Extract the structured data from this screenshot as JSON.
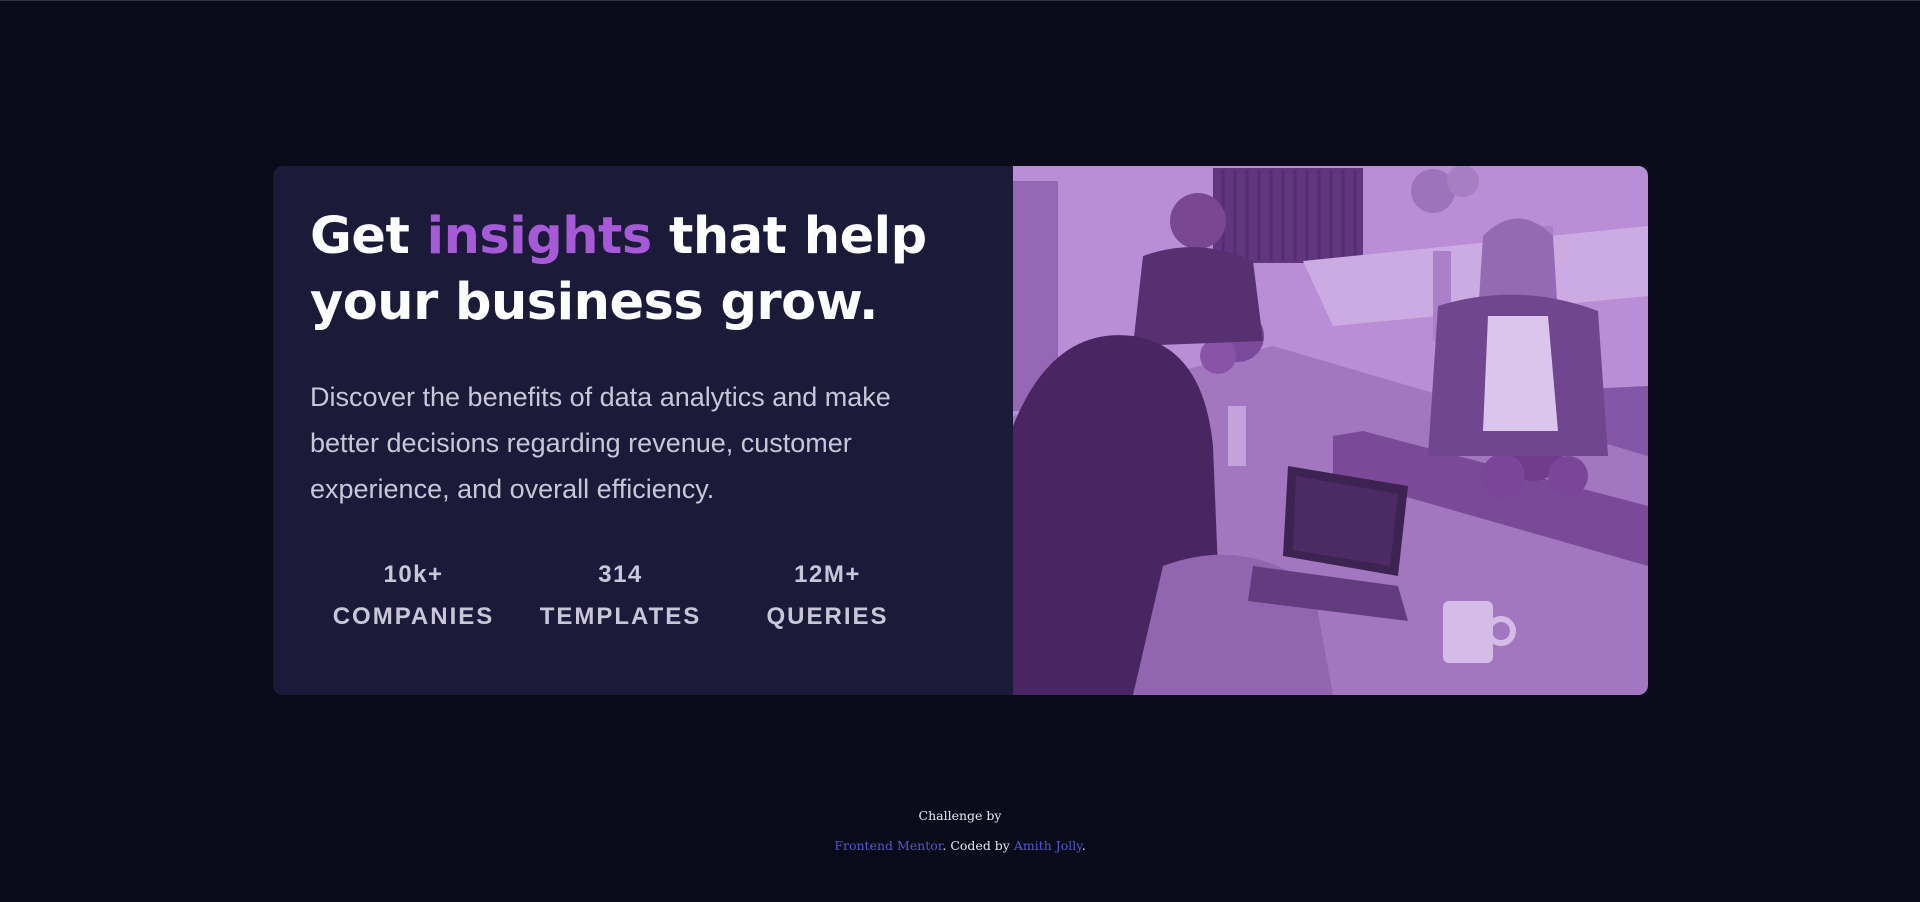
{
  "hero": {
    "headline_before": "Get ",
    "headline_accent": "insights",
    "headline_after": " that help your business grow.",
    "description": "Discover the benefits of data analytics and make better decisions regarding revenue, customer experience, and overall efficiency.",
    "stats": [
      {
        "value": "10k+",
        "label": "COMPANIES"
      },
      {
        "value": "314",
        "label": "TEMPLATES"
      },
      {
        "value": "12M+",
        "label": "QUERIES"
      }
    ],
    "image_icon": "office-photo-image"
  },
  "footer": {
    "line1": "Challenge by",
    "link1": "Frontend Mentor",
    "sep": ". Coded by ",
    "link2": "Amith Jolly",
    "end": "."
  },
  "colors": {
    "page_bg": "#090b1a",
    "card_bg": "#1c1a39",
    "accent": "#a75ad7",
    "text_muted": "#c9c6d8",
    "link": "#5457c9",
    "image_tint": "#a96ad4"
  }
}
